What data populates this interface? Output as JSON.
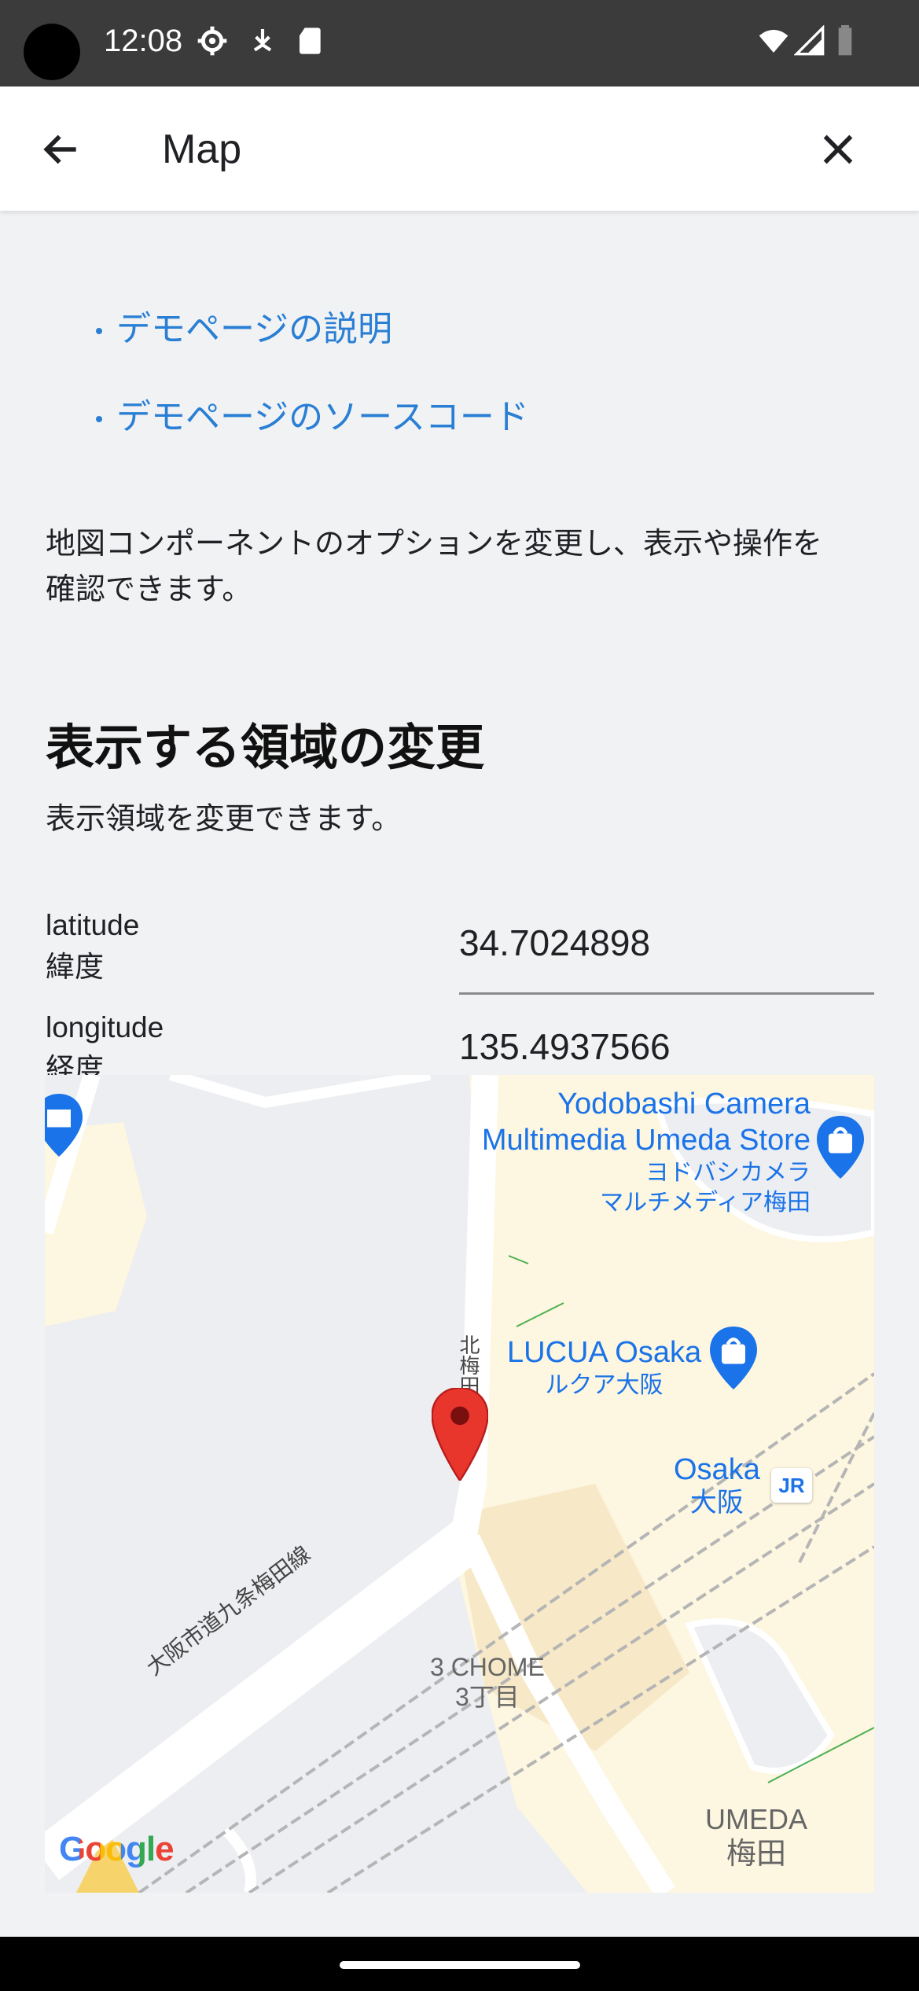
{
  "status_bar": {
    "time": "12:08"
  },
  "app_bar": {
    "title": "Map"
  },
  "links": [
    {
      "label": "デモページの説明"
    },
    {
      "label": "デモページのソースコード"
    }
  ],
  "intro": {
    "text_line1": "地図コンポーネントのオプションを変更し、表示や操作を",
    "text_line2": "確認できます。"
  },
  "section": {
    "heading": "表示する領域の変更",
    "subtext": "表示領域を変更できます。"
  },
  "fields": {
    "latitude": {
      "label_en": "latitude",
      "label_ja": "緯度",
      "value": "34.7024898"
    },
    "longitude": {
      "label_en": "longitude",
      "label_ja": "経度",
      "value": "135.4937566"
    }
  },
  "map": {
    "places": {
      "yodobashi_en1": "Yodobashi Camera",
      "yodobashi_en2": "Multimedia Umeda Store",
      "yodobashi_ja1": "ヨドバシカメラ",
      "yodobashi_ja2": "マルチメディア梅田",
      "lucua_en": "LUCUA Osaka",
      "lucua_ja": "ルクア大阪",
      "osaka_en": "Osaka",
      "osaka_ja": "大阪",
      "chome_en": "3 CHOME",
      "chome_ja": "3丁目",
      "umeda_en": "UMEDA",
      "umeda_ja": "梅田",
      "umeda_small": "梅田",
      "road_main": "大阪市道九条梅田線",
      "road_north": "北梅田",
      "jr_badge": "JR"
    },
    "logo": "Google",
    "colors": {
      "pin": "#e8362d",
      "poi": "#1a73e8",
      "land": "#fdf6e0",
      "road": "#ffffff"
    }
  },
  "colors": {
    "link": "#2a7fd4",
    "background": "#f1f2f4"
  }
}
